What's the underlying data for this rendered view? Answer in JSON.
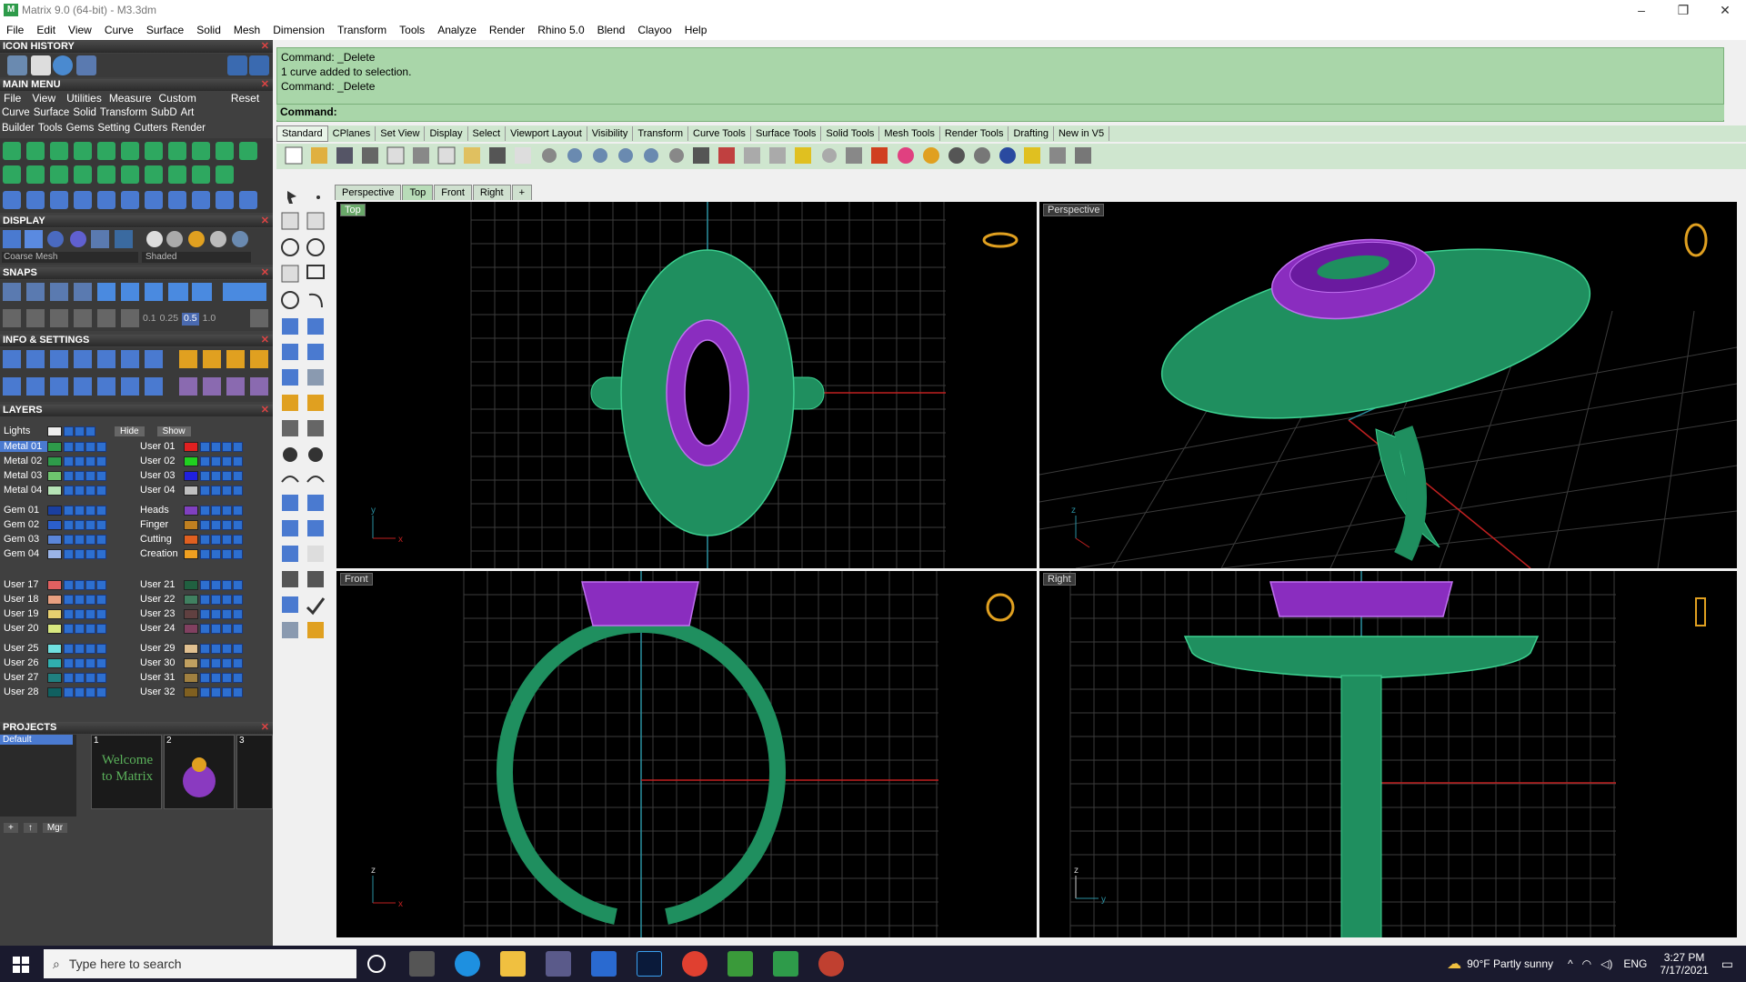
{
  "titlebar": {
    "title": "Matrix 9.0 (64-bit) - M3.3dm"
  },
  "menu": [
    "File",
    "Edit",
    "View",
    "Curve",
    "Surface",
    "Solid",
    "Mesh",
    "Dimension",
    "Transform",
    "Tools",
    "Analyze",
    "Render",
    "Rhino 5.0",
    "Blend",
    "Clayoo",
    "Help"
  ],
  "panels": {
    "icon_history": "ICON HISTORY",
    "main_menu": "MAIN MENU",
    "main_menu_items": [
      "File",
      "View",
      "Utilities",
      "Measure",
      "Custom",
      "Reset"
    ],
    "main_menu_row2": [
      "Curve",
      "Surface",
      "Solid",
      "Transform",
      "SubD",
      "Art"
    ],
    "main_menu_row3": [
      "Builder",
      "Tools",
      "Gems",
      "Setting",
      "Cutters",
      "Render"
    ],
    "display": "DISPLAY",
    "display_mesh": "Coarse Mesh",
    "display_mode": "Shaded",
    "snaps": "SNAPS",
    "snap_values": [
      "0.1",
      "0.25",
      "0.5",
      "1.0"
    ],
    "info": "INFO & SETTINGS",
    "layers": "LAYERS",
    "layers_lights": "Lights",
    "layers_hide": "Hide",
    "layers_show": "Show",
    "projects": "PROJECTS",
    "project_default": "Default",
    "project_thumbs": [
      "1",
      "2",
      "3"
    ],
    "project_welcome": "Welcome to Matrix",
    "mgr": "Mgr"
  },
  "layers_left": [
    "Metal 01",
    "Metal 02",
    "Metal 03",
    "Metal 04",
    "Gem 01",
    "Gem 02",
    "Gem 03",
    "Gem 04",
    "User 17",
    "User 18",
    "User 19",
    "User 20",
    "User 25",
    "User 26",
    "User 27",
    "User 28"
  ],
  "layers_right": [
    "User 01",
    "User 02",
    "User 03",
    "User 04",
    "Heads",
    "Finger",
    "Cutting",
    "Creation",
    "User 21",
    "User 22",
    "User 23",
    "User 24",
    "User 29",
    "User 30",
    "User 31",
    "User 32"
  ],
  "layer_colors_left": [
    "#2e9b4a",
    "#2e9b4a",
    "#6ec46e",
    "#b6e3b6",
    "#1a3fa0",
    "#2b5fcc",
    "#5b86d8",
    "#9ab4e8",
    "#e06060",
    "#e8a080",
    "#e8d070",
    "#d8e880",
    "#70e0e0",
    "#30b0b0",
    "#208080",
    "#106060"
  ],
  "layer_colors_right": [
    "#e02020",
    "#20d020",
    "#2020e0",
    "#c0c0c0",
    "#8040c0",
    "#c08020",
    "#e06020",
    "#f0a020",
    "#206040",
    "#408060",
    "#604040",
    "#804060",
    "#e0c090",
    "#c0a060",
    "#a08040",
    "#806020"
  ],
  "command": {
    "lines": [
      "Command: _Delete",
      "1 curve added to selection.",
      "Command: _Delete"
    ],
    "prompt": "Command:"
  },
  "toolbar_tabs": [
    "Standard",
    "CPlanes",
    "Set View",
    "Display",
    "Select",
    "Viewport Layout",
    "Visibility",
    "Transform",
    "Curve Tools",
    "Surface Tools",
    "Solid Tools",
    "Mesh Tools",
    "Render Tools",
    "Drafting",
    "New in V5"
  ],
  "viewport_tabs": [
    "Perspective",
    "Top",
    "Front",
    "Right",
    "+"
  ],
  "viewports": {
    "top": "Top",
    "perspective": "Perspective",
    "front": "Front",
    "right": "Right"
  },
  "axes": {
    "x": "x",
    "y": "y",
    "z": "z"
  },
  "taskbar": {
    "search_placeholder": "Type here to search",
    "weather": "90°F  Partly sunny",
    "lang": "ENG",
    "time": "3:27 PM",
    "date": "7/17/2021"
  },
  "colors": {
    "ring_green": "#1f8f5f",
    "gem_purple": "#8a2dbf",
    "grid": "#3c3c3c",
    "command_bg": "#a9d6a9"
  }
}
